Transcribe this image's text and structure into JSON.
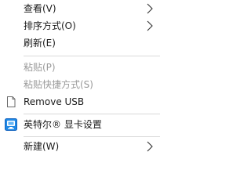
{
  "context_menu": {
    "items": [
      {
        "label": "查看(V)",
        "has_submenu": true,
        "enabled": true
      },
      {
        "label": "排序方式(O)",
        "has_submenu": true,
        "enabled": true
      },
      {
        "label": "刷新(E)",
        "has_submenu": false,
        "enabled": true
      },
      {
        "label": "粘贴(P)",
        "has_submenu": false,
        "enabled": false
      },
      {
        "label": "粘贴快捷方式(S)",
        "has_submenu": false,
        "enabled": false
      },
      {
        "label": "Remove USB",
        "has_submenu": false,
        "enabled": true,
        "icon": "document-icon"
      },
      {
        "label": "英特尔® 显卡设置",
        "has_submenu": false,
        "enabled": true,
        "icon": "intel-graphics-icon"
      },
      {
        "label": "新建(W)",
        "has_submenu": true,
        "enabled": true
      }
    ]
  },
  "colors": {
    "text": "#1a1a1a",
    "disabled_text": "#9a9a9a",
    "separator": "#d9d9d9",
    "background": "#ffffff",
    "intel_icon_blue": "#1e88e5"
  }
}
